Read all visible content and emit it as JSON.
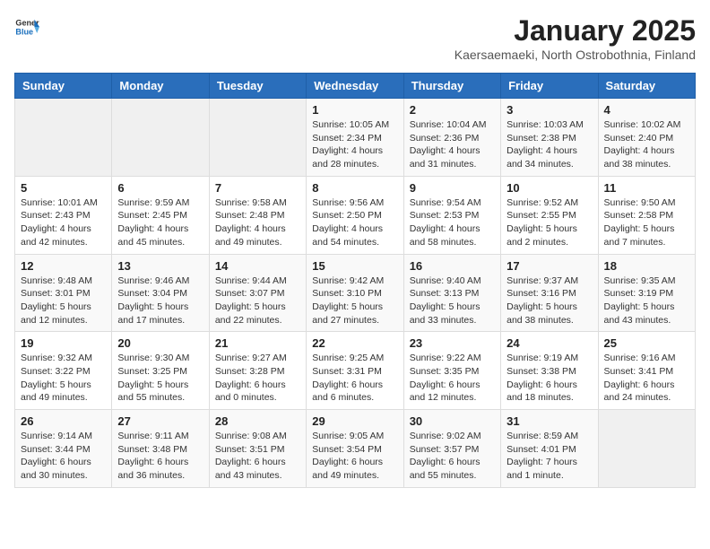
{
  "header": {
    "logo_general": "General",
    "logo_blue": "Blue",
    "title": "January 2025",
    "subtitle": "Kaersaemaeki, North Ostrobothnia, Finland"
  },
  "weekdays": [
    "Sunday",
    "Monday",
    "Tuesday",
    "Wednesday",
    "Thursday",
    "Friday",
    "Saturday"
  ],
  "weeks": [
    [
      {
        "day": "",
        "info": ""
      },
      {
        "day": "",
        "info": ""
      },
      {
        "day": "",
        "info": ""
      },
      {
        "day": "1",
        "info": "Sunrise: 10:05 AM\nSunset: 2:34 PM\nDaylight: 4 hours and 28 minutes."
      },
      {
        "day": "2",
        "info": "Sunrise: 10:04 AM\nSunset: 2:36 PM\nDaylight: 4 hours and 31 minutes."
      },
      {
        "day": "3",
        "info": "Sunrise: 10:03 AM\nSunset: 2:38 PM\nDaylight: 4 hours and 34 minutes."
      },
      {
        "day": "4",
        "info": "Sunrise: 10:02 AM\nSunset: 2:40 PM\nDaylight: 4 hours and 38 minutes."
      }
    ],
    [
      {
        "day": "5",
        "info": "Sunrise: 10:01 AM\nSunset: 2:43 PM\nDaylight: 4 hours and 42 minutes."
      },
      {
        "day": "6",
        "info": "Sunrise: 9:59 AM\nSunset: 2:45 PM\nDaylight: 4 hours and 45 minutes."
      },
      {
        "day": "7",
        "info": "Sunrise: 9:58 AM\nSunset: 2:48 PM\nDaylight: 4 hours and 49 minutes."
      },
      {
        "day": "8",
        "info": "Sunrise: 9:56 AM\nSunset: 2:50 PM\nDaylight: 4 hours and 54 minutes."
      },
      {
        "day": "9",
        "info": "Sunrise: 9:54 AM\nSunset: 2:53 PM\nDaylight: 4 hours and 58 minutes."
      },
      {
        "day": "10",
        "info": "Sunrise: 9:52 AM\nSunset: 2:55 PM\nDaylight: 5 hours and 2 minutes."
      },
      {
        "day": "11",
        "info": "Sunrise: 9:50 AM\nSunset: 2:58 PM\nDaylight: 5 hours and 7 minutes."
      }
    ],
    [
      {
        "day": "12",
        "info": "Sunrise: 9:48 AM\nSunset: 3:01 PM\nDaylight: 5 hours and 12 minutes."
      },
      {
        "day": "13",
        "info": "Sunrise: 9:46 AM\nSunset: 3:04 PM\nDaylight: 5 hours and 17 minutes."
      },
      {
        "day": "14",
        "info": "Sunrise: 9:44 AM\nSunset: 3:07 PM\nDaylight: 5 hours and 22 minutes."
      },
      {
        "day": "15",
        "info": "Sunrise: 9:42 AM\nSunset: 3:10 PM\nDaylight: 5 hours and 27 minutes."
      },
      {
        "day": "16",
        "info": "Sunrise: 9:40 AM\nSunset: 3:13 PM\nDaylight: 5 hours and 33 minutes."
      },
      {
        "day": "17",
        "info": "Sunrise: 9:37 AM\nSunset: 3:16 PM\nDaylight: 5 hours and 38 minutes."
      },
      {
        "day": "18",
        "info": "Sunrise: 9:35 AM\nSunset: 3:19 PM\nDaylight: 5 hours and 43 minutes."
      }
    ],
    [
      {
        "day": "19",
        "info": "Sunrise: 9:32 AM\nSunset: 3:22 PM\nDaylight: 5 hours and 49 minutes."
      },
      {
        "day": "20",
        "info": "Sunrise: 9:30 AM\nSunset: 3:25 PM\nDaylight: 5 hours and 55 minutes."
      },
      {
        "day": "21",
        "info": "Sunrise: 9:27 AM\nSunset: 3:28 PM\nDaylight: 6 hours and 0 minutes."
      },
      {
        "day": "22",
        "info": "Sunrise: 9:25 AM\nSunset: 3:31 PM\nDaylight: 6 hours and 6 minutes."
      },
      {
        "day": "23",
        "info": "Sunrise: 9:22 AM\nSunset: 3:35 PM\nDaylight: 6 hours and 12 minutes."
      },
      {
        "day": "24",
        "info": "Sunrise: 9:19 AM\nSunset: 3:38 PM\nDaylight: 6 hours and 18 minutes."
      },
      {
        "day": "25",
        "info": "Sunrise: 9:16 AM\nSunset: 3:41 PM\nDaylight: 6 hours and 24 minutes."
      }
    ],
    [
      {
        "day": "26",
        "info": "Sunrise: 9:14 AM\nSunset: 3:44 PM\nDaylight: 6 hours and 30 minutes."
      },
      {
        "day": "27",
        "info": "Sunrise: 9:11 AM\nSunset: 3:48 PM\nDaylight: 6 hours and 36 minutes."
      },
      {
        "day": "28",
        "info": "Sunrise: 9:08 AM\nSunset: 3:51 PM\nDaylight: 6 hours and 43 minutes."
      },
      {
        "day": "29",
        "info": "Sunrise: 9:05 AM\nSunset: 3:54 PM\nDaylight: 6 hours and 49 minutes."
      },
      {
        "day": "30",
        "info": "Sunrise: 9:02 AM\nSunset: 3:57 PM\nDaylight: 6 hours and 55 minutes."
      },
      {
        "day": "31",
        "info": "Sunrise: 8:59 AM\nSunset: 4:01 PM\nDaylight: 7 hours and 1 minute."
      },
      {
        "day": "",
        "info": ""
      }
    ]
  ]
}
